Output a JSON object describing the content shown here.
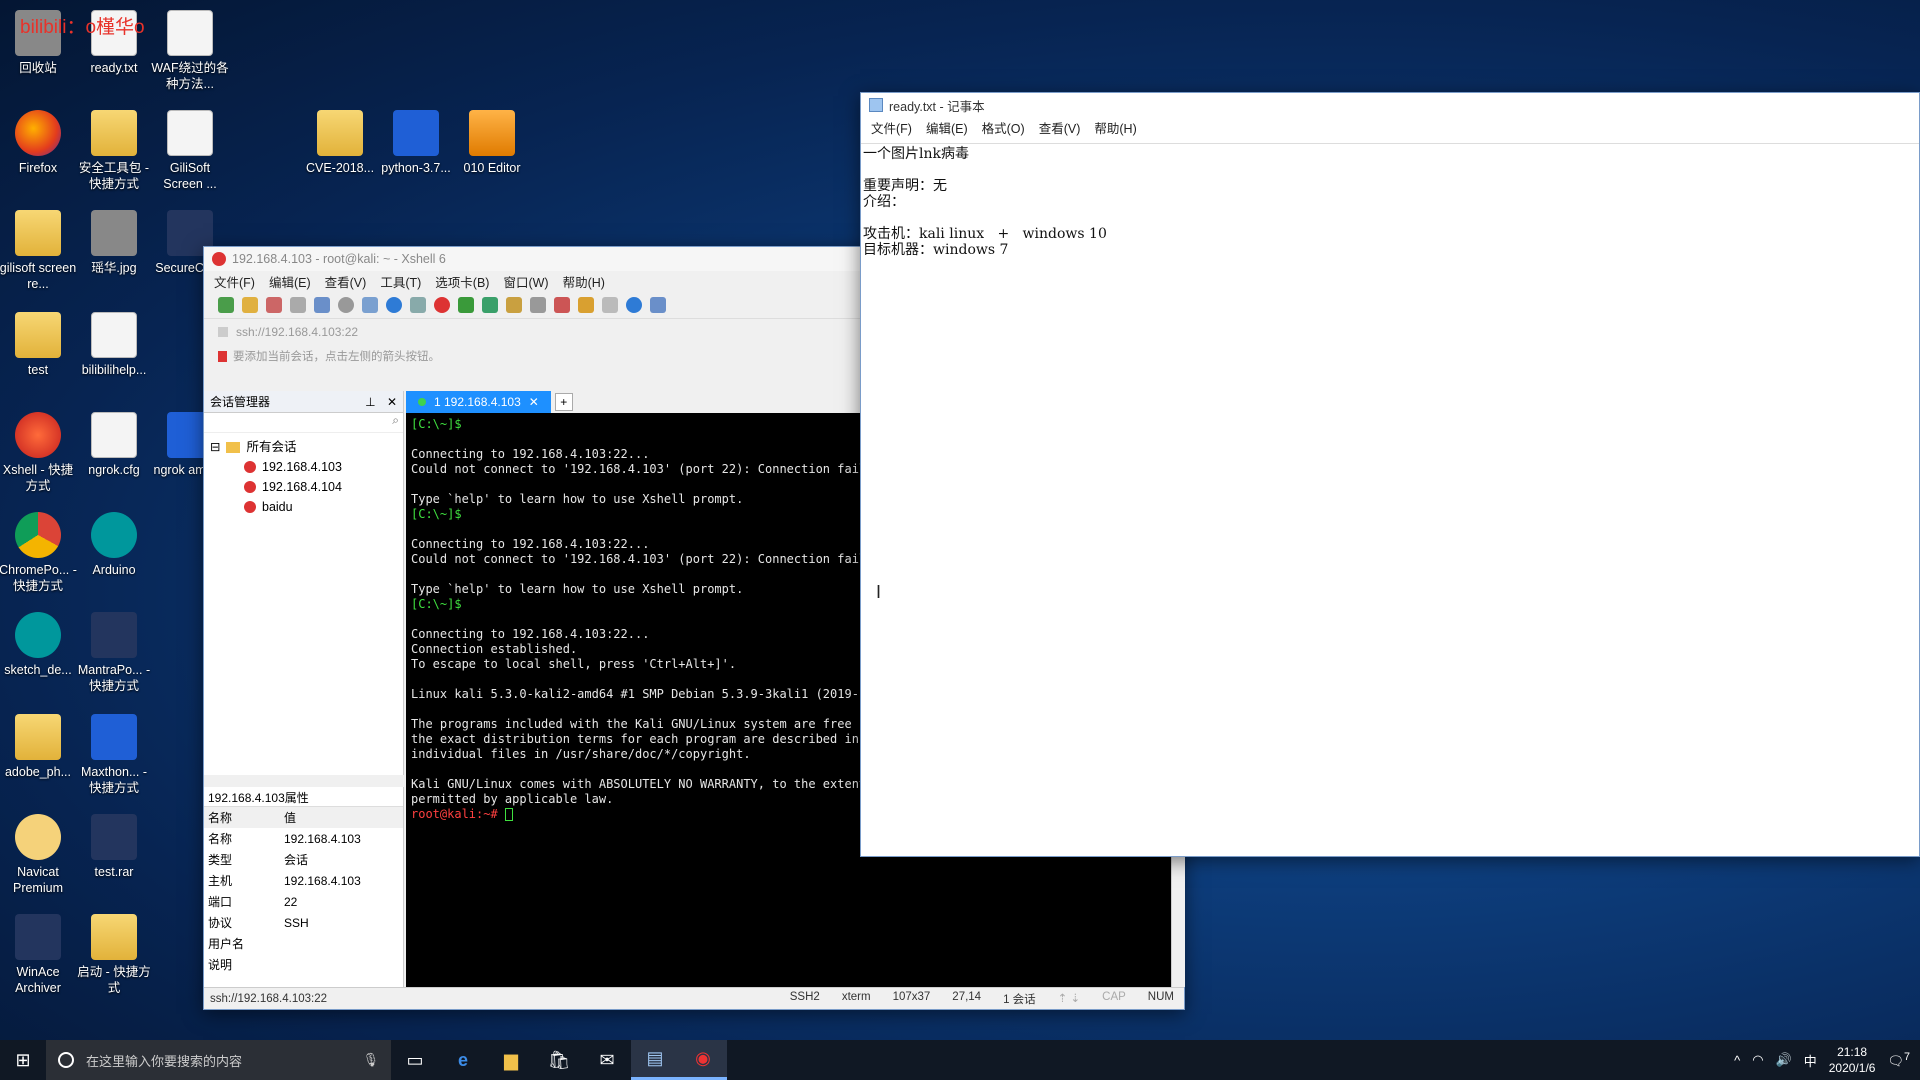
{
  "watermark": "bilibili：o槿华o",
  "desktop_icons": [
    {
      "id": "recycle",
      "label": "回收站",
      "icon": "recycle-bin-icon"
    },
    {
      "id": "ready",
      "label": "ready.txt",
      "icon": "text-file-icon"
    },
    {
      "id": "waf",
      "label": "WAF绕过的各种方法...",
      "icon": "pdf-file-icon"
    },
    {
      "id": "firefox",
      "label": "Firefox",
      "icon": "firefox-icon"
    },
    {
      "id": "safety",
      "label": "安全工具包 - 快捷方式",
      "icon": "folder-shortcut-icon"
    },
    {
      "id": "gilisoft",
      "label": "GiliSoft Screen ...",
      "icon": "file-icon"
    },
    {
      "id": "cve",
      "label": "CVE-2018...",
      "icon": "folder-icon"
    },
    {
      "id": "python",
      "label": "python-3.7...",
      "icon": "python-installer-icon"
    },
    {
      "id": "editor010",
      "label": "010 Editor",
      "icon": "editor-icon"
    },
    {
      "id": "gilisoft2",
      "label": "gilisoft screen re...",
      "icon": "folder-icon"
    },
    {
      "id": "yaohua",
      "label": "瑶华.jpg",
      "icon": "image-icon"
    },
    {
      "id": "securecrt",
      "label": "SecureC 8.3",
      "icon": "securecrt-icon"
    },
    {
      "id": "test",
      "label": "test",
      "icon": "folder-icon"
    },
    {
      "id": "bilibilihelp",
      "label": "bilibilihelp...",
      "icon": "file-icon"
    },
    {
      "id": "xshell",
      "label": "Xshell - 快捷方式",
      "icon": "xshell-icon"
    },
    {
      "id": "ngrokcfg",
      "label": "ngrok.cfg",
      "icon": "file-icon"
    },
    {
      "id": "ngrok",
      "label": "ngrok amd64",
      "icon": "app-icon"
    },
    {
      "id": "chrome",
      "label": "ChromePo... - 快捷方式",
      "icon": "chrome-icon"
    },
    {
      "id": "arduino",
      "label": "Arduino",
      "icon": "arduino-icon"
    },
    {
      "id": "sketch",
      "label": "sketch_de...",
      "icon": "arduino-sketch-icon"
    },
    {
      "id": "mantra",
      "label": "MantraPo... - 快捷方式",
      "icon": "mantra-icon"
    },
    {
      "id": "adobe",
      "label": "adobe_ph...",
      "icon": "folder-icon"
    },
    {
      "id": "maxthon",
      "label": "Maxthon... - 快捷方式",
      "icon": "maxthon-icon"
    },
    {
      "id": "navicat",
      "label": "Navicat Premium",
      "icon": "navicat-icon"
    },
    {
      "id": "testrar",
      "label": "test.rar",
      "icon": "rar-icon"
    },
    {
      "id": "winace",
      "label": "WinAce Archiver",
      "icon": "winace-icon"
    },
    {
      "id": "startup",
      "label": "启动 - 快捷方式",
      "icon": "file-shortcut-icon"
    }
  ],
  "xshell": {
    "title": "192.168.4.103 - root@kali: ~ - Xshell 6",
    "menu": [
      "文件(F)",
      "编辑(E)",
      "查看(V)",
      "工具(T)",
      "选项卡(B)",
      "窗口(W)",
      "帮助(H)"
    ],
    "address": "ssh://192.168.4.103:22",
    "hint": "要添加当前会话，点击左侧的箭头按钮。",
    "session_manager": {
      "title": "会话管理器",
      "root": "所有会话",
      "sessions": [
        "192.168.4.103",
        "192.168.4.104",
        "baidu"
      ]
    },
    "properties": {
      "title": "192.168.4.103属性",
      "col_name": "名称",
      "col_value": "值",
      "rows": [
        {
          "k": "名称",
          "v": "192.168.4.103"
        },
        {
          "k": "类型",
          "v": "会话"
        },
        {
          "k": "主机",
          "v": "192.168.4.103"
        },
        {
          "k": "端口",
          "v": "22"
        },
        {
          "k": "协议",
          "v": "SSH"
        },
        {
          "k": "用户名",
          "v": ""
        },
        {
          "k": "说明",
          "v": ""
        }
      ]
    },
    "tab": {
      "label": "1 192.168.4.103",
      "add": "+"
    },
    "terminal_lines": [
      {
        "c": "g",
        "t": "[C:\\~]$"
      },
      {
        "c": "",
        "t": ""
      },
      {
        "c": "",
        "t": "Connecting to 192.168.4.103:22..."
      },
      {
        "c": "",
        "t": "Could not connect to '192.168.4.103' (port 22): Connection faile"
      },
      {
        "c": "",
        "t": ""
      },
      {
        "c": "",
        "t": "Type `help' to learn how to use Xshell prompt."
      },
      {
        "c": "g",
        "t": "[C:\\~]$"
      },
      {
        "c": "",
        "t": ""
      },
      {
        "c": "",
        "t": "Connecting to 192.168.4.103:22..."
      },
      {
        "c": "",
        "t": "Could not connect to '192.168.4.103' (port 22): Connection faile"
      },
      {
        "c": "",
        "t": ""
      },
      {
        "c": "",
        "t": "Type `help' to learn how to use Xshell prompt."
      },
      {
        "c": "g",
        "t": "[C:\\~]$"
      },
      {
        "c": "",
        "t": ""
      },
      {
        "c": "",
        "t": "Connecting to 192.168.4.103:22..."
      },
      {
        "c": "",
        "t": "Connection established."
      },
      {
        "c": "",
        "t": "To escape to local shell, press 'Ctrl+Alt+]'."
      },
      {
        "c": "",
        "t": ""
      },
      {
        "c": "",
        "t": "Linux kali 5.3.0-kali2-amd64 #1 SMP Debian 5.3.9-3kali1 (2019-11"
      },
      {
        "c": "",
        "t": ""
      },
      {
        "c": "",
        "t": "The programs included with the Kali GNU/Linux system are free so"
      },
      {
        "c": "",
        "t": "the exact distribution terms for each program are described in t"
      },
      {
        "c": "",
        "t": "individual files in /usr/share/doc/*/copyright."
      },
      {
        "c": "",
        "t": ""
      },
      {
        "c": "",
        "t": "Kali GNU/Linux comes with ABSOLUTELY NO WARRANTY, to the extent"
      },
      {
        "c": "",
        "t": "permitted by applicable law."
      }
    ],
    "prompt": "root@kali:~#",
    "status": {
      "left": "ssh://192.168.4.103:22",
      "protocol": "SSH2",
      "term": "xterm",
      "size": "107x37",
      "pos": "27,14",
      "sessions": "1 会话",
      "cap": "CAP",
      "num": "NUM"
    }
  },
  "notepad": {
    "title": "ready.txt - 记事本",
    "menu": [
      "文件(F)",
      "编辑(E)",
      "格式(O)",
      "查看(V)",
      "帮助(H)"
    ],
    "content": "一个图片lnk病毒\n\n重要声明：无\n介绍：\n\n攻击机：kali linux   +   windows 10\n目标机器：windows 7\n"
  },
  "taskbar": {
    "search_placeholder": "在这里输入你要搜索的内容",
    "time": "21:18",
    "date": "2020/1/6",
    "ime": "中",
    "notification_count": "7"
  }
}
